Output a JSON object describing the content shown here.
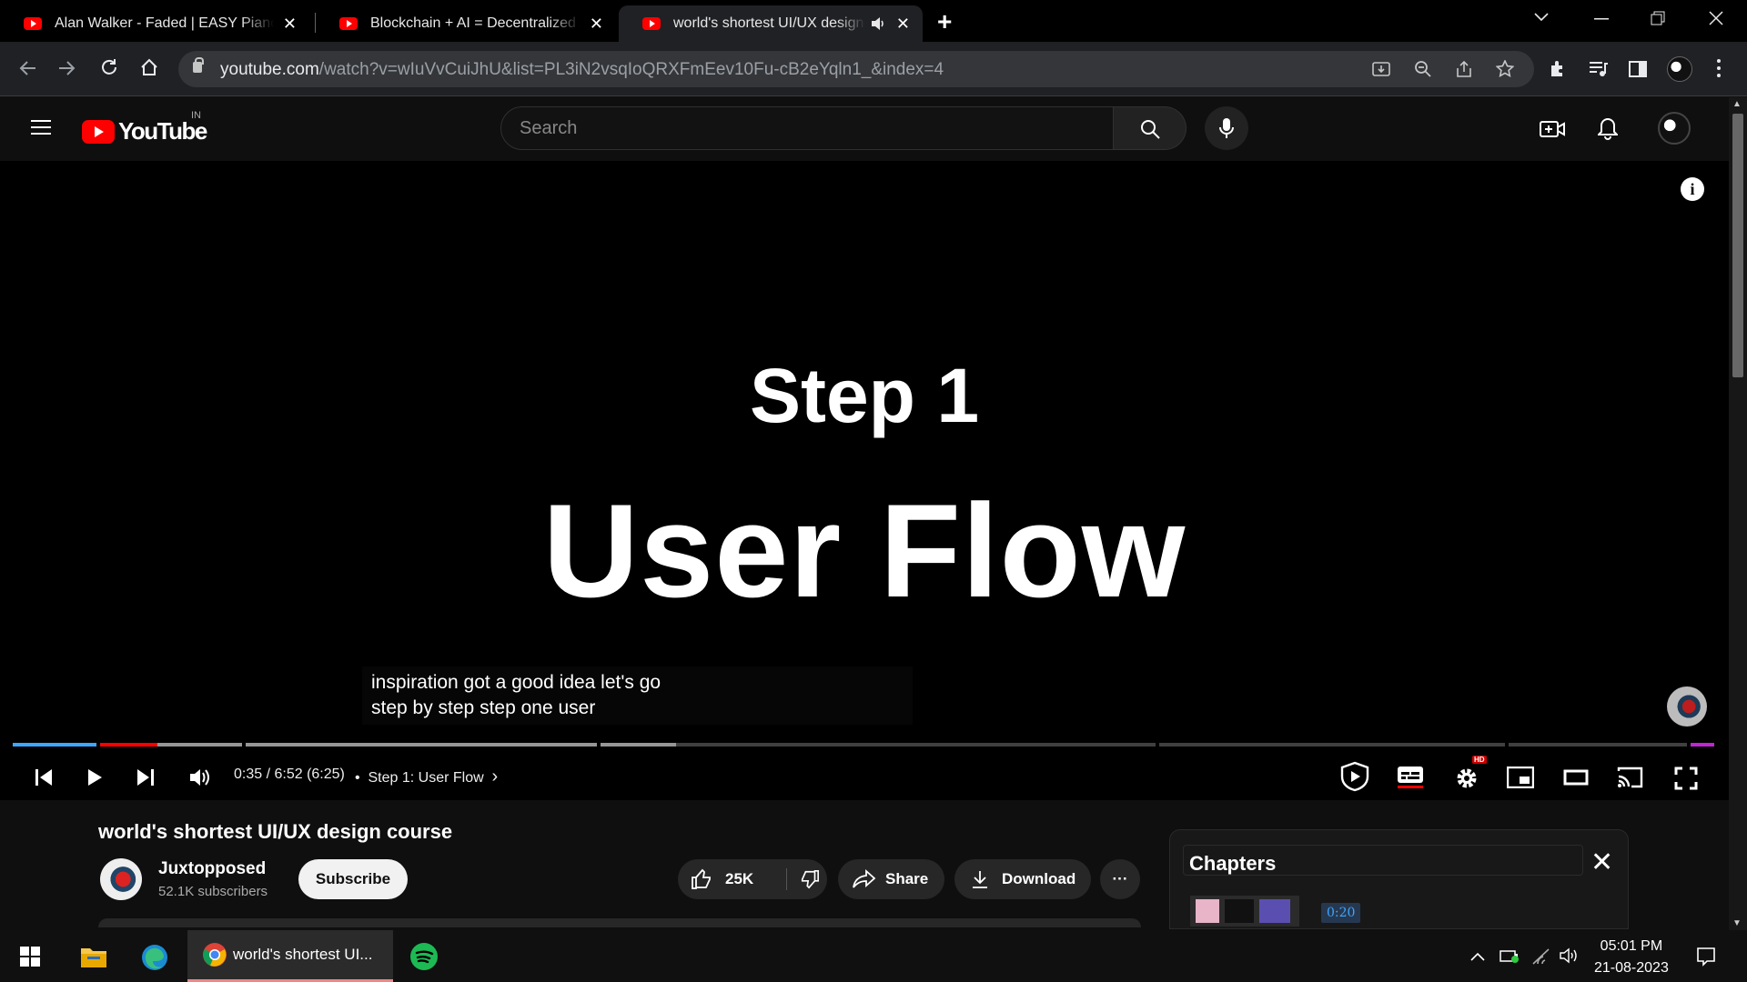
{
  "browser": {
    "tabs": [
      {
        "title": "Alan Walker - Faded | EASY Piano",
        "close": "✕"
      },
      {
        "title": "Blockchain + AI = Decentralized A",
        "close": "✕"
      },
      {
        "title": "world's shortest UI/UX design",
        "close": "✕",
        "muted_icon": "speaker-icon"
      }
    ],
    "new_tab": "+",
    "url_domain": "youtube.com",
    "url_path": "/watch?v=wIuVvCuiJhU&list=PL3iN2vsqIoQRXFmEev10Fu-cB2eYqln1_&index=4"
  },
  "youtube": {
    "country": "IN",
    "logo_text": "YouTube",
    "search_placeholder": "Search"
  },
  "player": {
    "step_label": "Step 1",
    "heading": "User Flow",
    "caption_line1": "inspiration got a good idea let's go",
    "caption_line2": "step by step step one user",
    "time": "0:35 / 6:52 (6:25)",
    "chapter_separator": "•",
    "chapter": "Step 1: User Flow",
    "chapter_arrow": "›",
    "hd_badge": "HD",
    "info": "i",
    "progress_played_fraction": 0.085,
    "progress_buffered_fraction": 0.39
  },
  "video": {
    "title": "world's shortest UI/UX design course",
    "channel": "Juxtopposed",
    "subscribers": "52.1K subscribers",
    "subscribe_label": "Subscribe",
    "likes": "25K",
    "share_label": "Share",
    "download_label": "Download",
    "more": "···"
  },
  "chapters_panel": {
    "title": "Chapters",
    "close": "✕",
    "first_time": "0:20"
  },
  "taskbar": {
    "active_window": "world's shortest UI...",
    "time": "05:01 PM",
    "date": "21-08-2023"
  },
  "colors": {
    "youtube_red": "#ff0000",
    "progress_red": "#ff0000",
    "chapter_blue": "#3ea6ff",
    "background": "#0f0f0f"
  }
}
